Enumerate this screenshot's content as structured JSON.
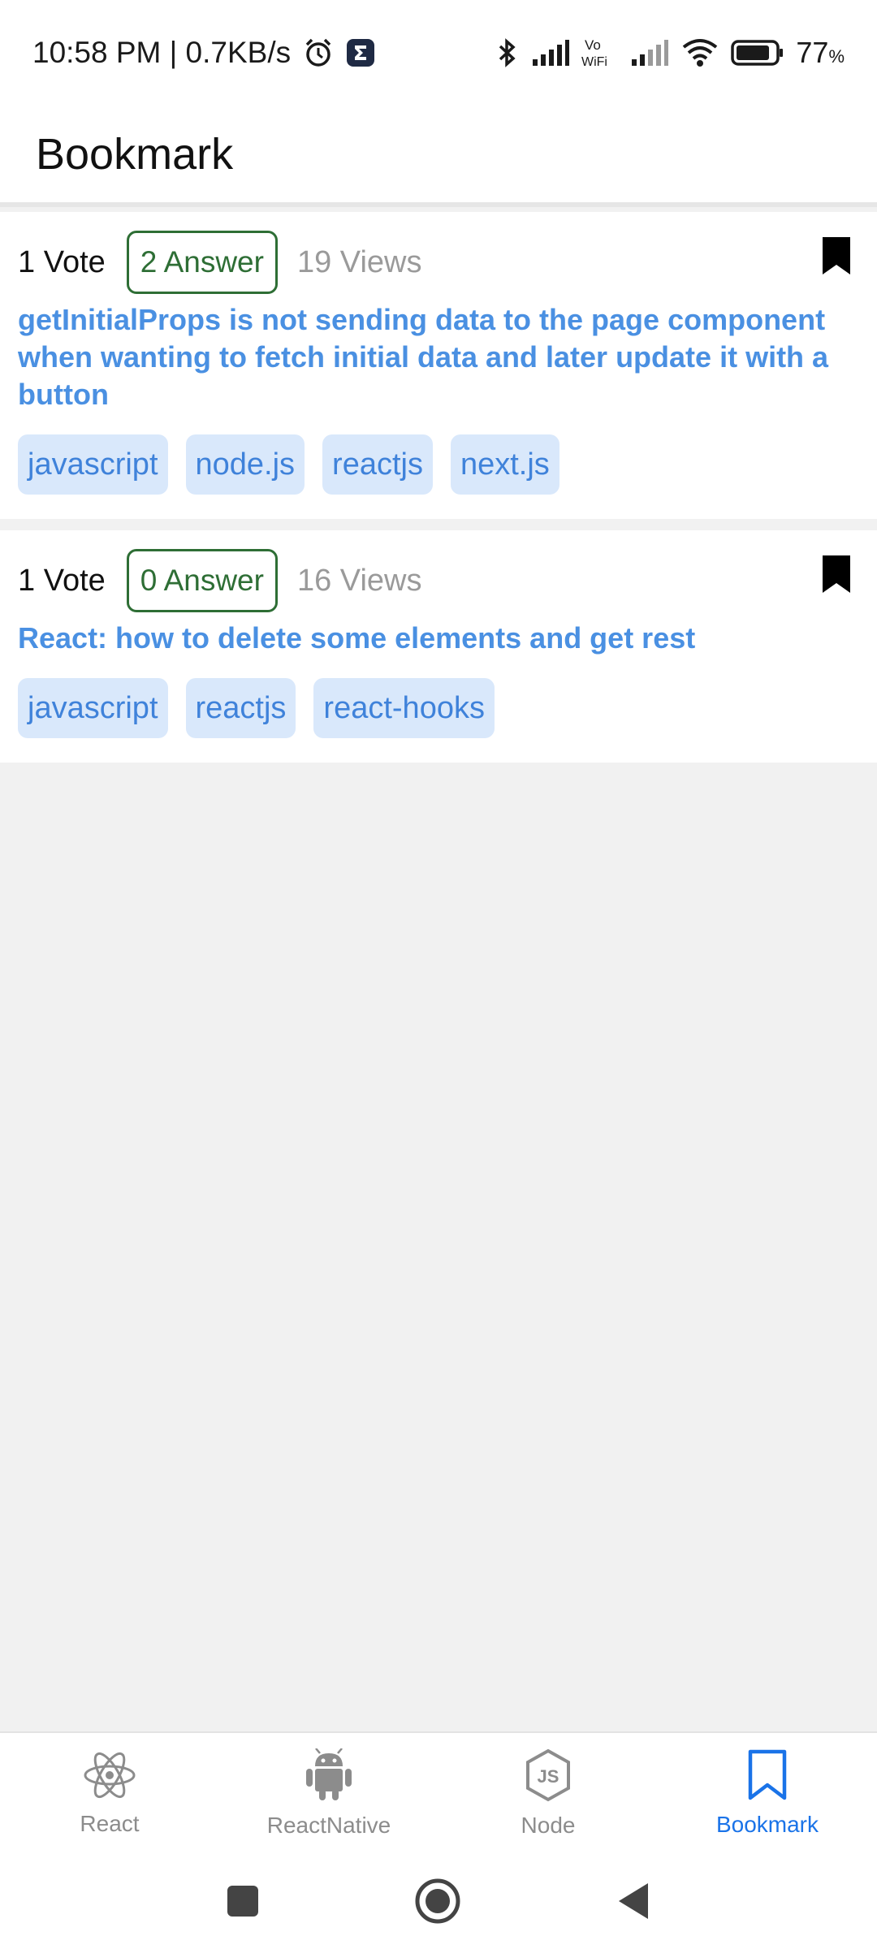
{
  "status_bar": {
    "time_speed": "10:58 PM | 0.7KB/s",
    "battery_percent": "77",
    "battery_unit": "%",
    "icons": [
      "alarm-icon",
      "app-notification-icon",
      "bluetooth-icon",
      "signal-icon",
      "vowifi-icon",
      "signal-icon",
      "wifi-icon",
      "battery-icon"
    ]
  },
  "header": {
    "title": "Bookmark"
  },
  "questions": [
    {
      "votes": "1 Vote",
      "answers": "2 Answer",
      "views": "19 Views",
      "title": "getInitialProps is not sending data to the page component when wanting to fetch initial data and later update it with a button",
      "tags": [
        "javascript",
        "node.js",
        "reactjs",
        "next.js"
      ],
      "bookmarked": true
    },
    {
      "votes": "1 Vote",
      "answers": "0 Answer",
      "views": "16 Views",
      "title": "React: how to delete some elements and get rest",
      "tags": [
        "javascript",
        "reactjs",
        "react-hooks"
      ],
      "bookmarked": true
    }
  ],
  "bottom_nav": {
    "items": [
      {
        "label": "React",
        "icon": "react-icon"
      },
      {
        "label": "ReactNative",
        "icon": "android-icon"
      },
      {
        "label": "Node",
        "icon": "nodejs-icon"
      },
      {
        "label": "Bookmark",
        "icon": "bookmark-icon"
      }
    ],
    "active": "Bookmark"
  },
  "colors": {
    "accent": "#1a73e8",
    "title_link": "#4a90e2",
    "answer_border": "#2e6e35",
    "tag_bg": "#d9e8fb",
    "tag_text": "#3f82da"
  }
}
